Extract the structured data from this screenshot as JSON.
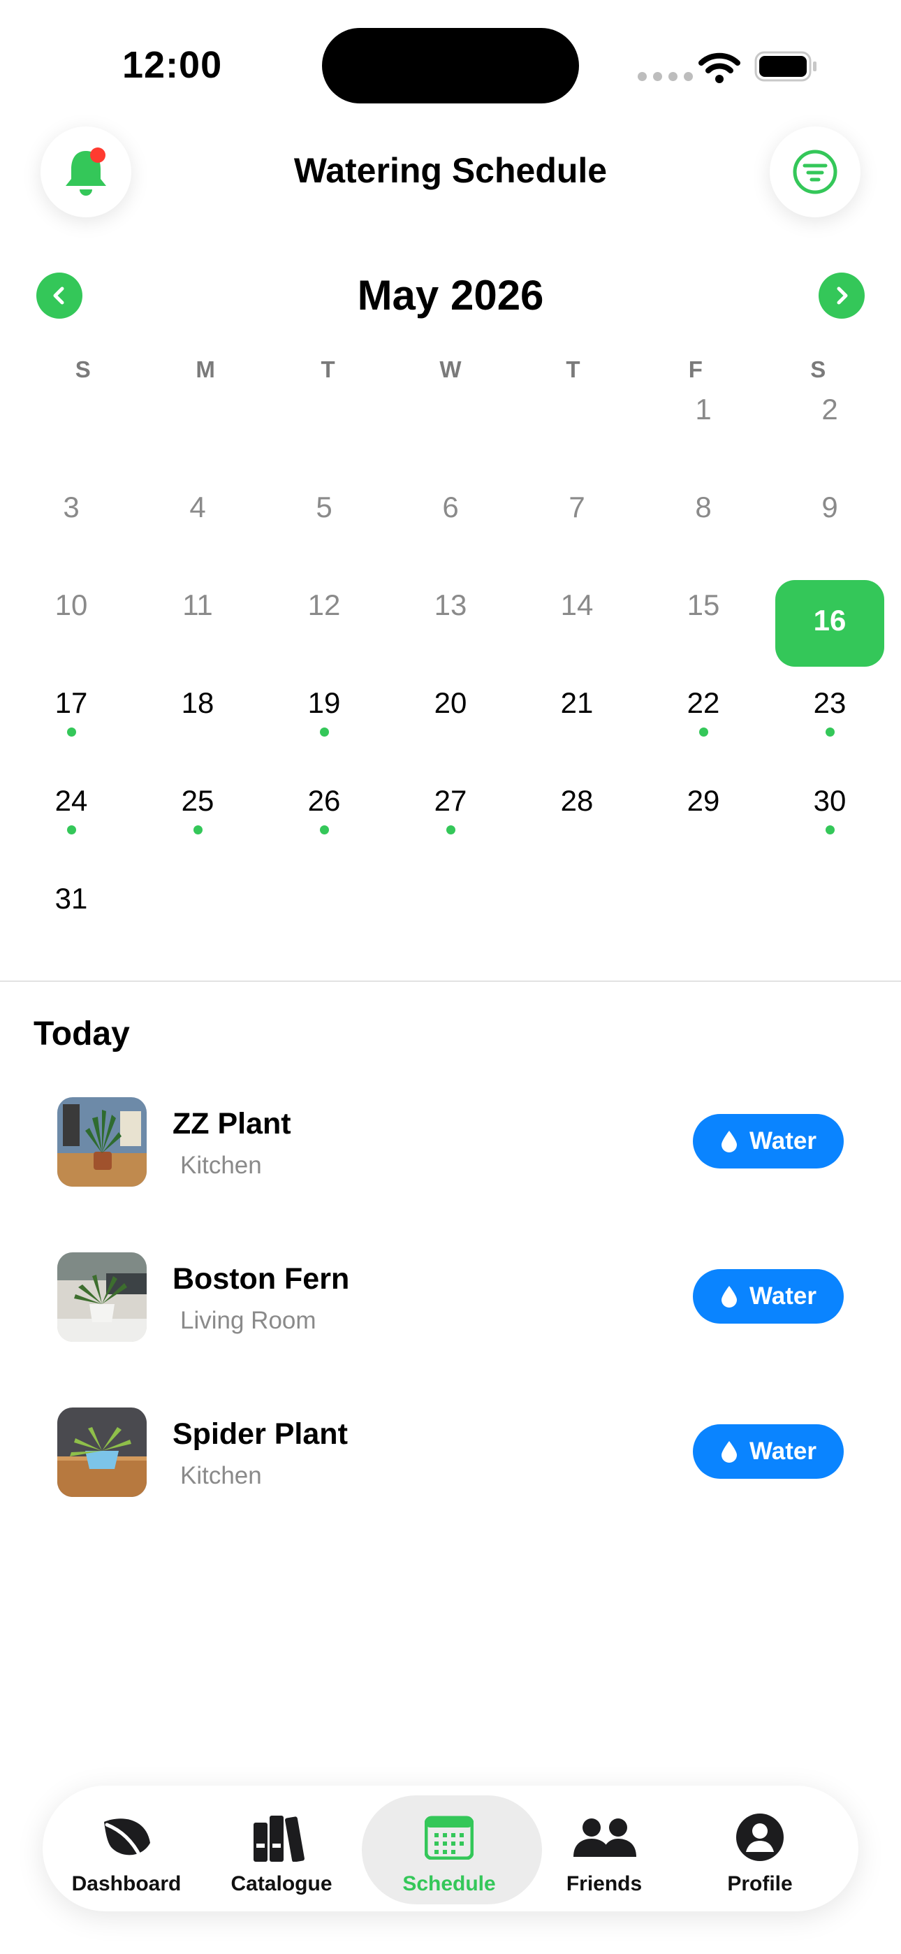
{
  "status_bar": {
    "time": "12:00"
  },
  "header": {
    "title": "Watering Schedule",
    "left_icon": "bell-icon",
    "right_icon": "filter-icon"
  },
  "calendar": {
    "month_label": "May 2026",
    "weekdays": [
      "S",
      "M",
      "T",
      "W",
      "T",
      "F",
      "S"
    ],
    "selected_day": "16",
    "days": [
      "1",
      "2",
      "3",
      "4",
      "5",
      "6",
      "7",
      "8",
      "9",
      "10",
      "11",
      "12",
      "13",
      "14",
      "15",
      "16",
      "17",
      "18",
      "19",
      "20",
      "21",
      "22",
      "23",
      "24",
      "25",
      "26",
      "27",
      "28",
      "29",
      "30",
      "31"
    ],
    "days_with_watering": [
      "17",
      "19",
      "22",
      "23",
      "24",
      "25",
      "26",
      "27",
      "30"
    ]
  },
  "today": {
    "title": "Today",
    "plants": [
      {
        "name": "ZZ Plant",
        "room": "Kitchen",
        "action": "Water"
      },
      {
        "name": "Boston Fern",
        "room": "Living Room",
        "action": "Water"
      },
      {
        "name": "Spider Plant",
        "room": "Kitchen",
        "action": "Water"
      }
    ]
  },
  "tabbar": {
    "tabs": [
      {
        "label": "Dashboard",
        "icon": "leaf-icon"
      },
      {
        "label": "Catalogue",
        "icon": "books-icon"
      },
      {
        "label": "Schedule",
        "icon": "calendar-icon"
      },
      {
        "label": "Friends",
        "icon": "people-icon"
      },
      {
        "label": "Profile",
        "icon": "person-circle-icon"
      }
    ],
    "active": "Schedule"
  },
  "colors": {
    "accent_green": "#34c759",
    "action_blue": "#0a84ff",
    "badge_red": "#ff3b30"
  }
}
